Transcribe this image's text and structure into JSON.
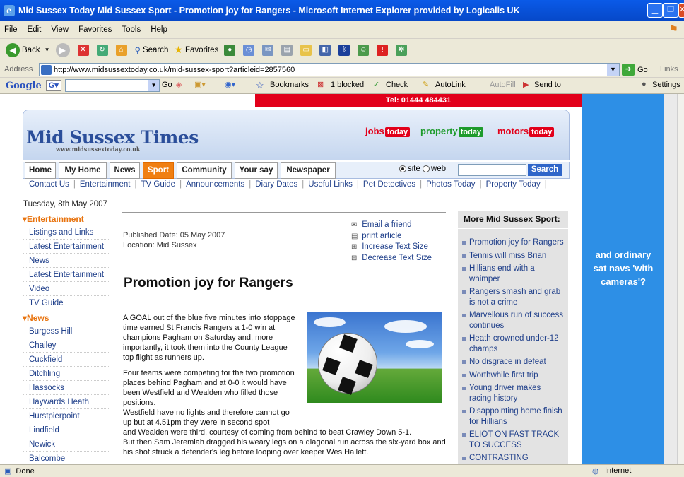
{
  "window": {
    "title": "Mid Sussex Today Mid Sussex Sport - Promotion joy for Rangers - Microsoft Internet Explorer provided by Logicalis UK"
  },
  "menu": [
    "File",
    "Edit",
    "View",
    "Favorites",
    "Tools",
    "Help"
  ],
  "toolbar": {
    "back": "Back",
    "search": "Search",
    "favorites": "Favorites"
  },
  "address": {
    "label": "Address",
    "url": "http://www.midsussextoday.co.uk/mid-sussex-sport?articleid=2857560",
    "go": "Go",
    "links": "Links"
  },
  "googlebar": {
    "logo": "Google",
    "go": "Go",
    "bookmarks": "Bookmarks",
    "blocked": "1 blocked",
    "check": "Check",
    "autolink": "AutoLink",
    "autofill": "AutoFill",
    "sendto": "Send to",
    "settings": "Settings"
  },
  "page": {
    "banner": "Tel: 01444 484431",
    "logo": "Mid Sussex Times",
    "logo_sub": "www.midsussextoday.co.uk",
    "brands": {
      "jobs": "jobs",
      "property": "property",
      "motors": "motors",
      "today": "today"
    },
    "tabs": [
      "Home",
      "My Home",
      "News",
      "Sport",
      "Community",
      "Your say",
      "Newspaper"
    ],
    "search": {
      "site": "site",
      "web": "web",
      "button": "Search"
    },
    "sublinks": [
      "Contact Us",
      "Entertainment",
      "TV Guide",
      "Announcements",
      "Diary Dates",
      "Useful Links",
      "Pet Detectives",
      "Photos Today",
      "Property Today"
    ],
    "date": "Tuesday, 8th May 2007",
    "leftnav": {
      "ent_head": "Entertainment",
      "ent_items": [
        "Listings and Links",
        "Latest Entertainment",
        "News",
        "Latest Entertainment",
        "Video",
        "TV Guide"
      ],
      "news_head": "News",
      "news_items": [
        "Burgess Hill",
        "Chailey",
        "Cuckfield",
        "Ditchling",
        "Hassocks",
        "Haywards Heath",
        "Hurstpierpoint",
        "Lindfield",
        "Newick",
        "Balcombe"
      ]
    },
    "meta": {
      "published": "Published Date: 05 May 2007",
      "location": "Location: Mid Sussex"
    },
    "tools": [
      "Email a friend",
      "print article",
      "Increase Text Size",
      "Decrease Text Size"
    ],
    "headline": "Promotion joy for Rangers",
    "p1": "A GOAL out of the blue five minutes into stoppage time earned St Francis Rangers a 1-0 win at champions Pagham on Saturday and, more importantly, it took them into the County League top flight as runners up.",
    "p2": "Four teams were competing for the two promotion places behind Pagham and at 0-0 it would have been Westfield and Wealden who filled those positions.",
    "p3a": "Westfield have no lights and therefore cannot go up but at 4.51pm they were in second spot",
    "p3b": "and Wealden were third, courtesy of coming from behind to beat Crawley Down 5-1.",
    "p4": "But then Sam Jeremiah dragged his weary legs on a diagonal run across the six-yard box and his shot struck a defender's leg before looping over keeper Wes Hallett.",
    "more_head": "More Mid Sussex Sport:",
    "more": [
      "Promotion joy for Rangers",
      "Tennis will miss Brian",
      "Hillians end with a whimper",
      "Rangers smash and grab is not a crime",
      "Marvellous run of success continues",
      "Heath crowned under-12 champs",
      "No disgrace in defeat",
      "Worthwhile first trip",
      "Young driver makes racing history",
      "Disappointing home finish for Hillians",
      "ELIOT ON FAST TRACK TO SUCCESS",
      "CONTRASTING"
    ],
    "ad": "and ordinary sat navs 'with cameras'?"
  },
  "status": {
    "left": "Done",
    "zone": "Internet"
  }
}
